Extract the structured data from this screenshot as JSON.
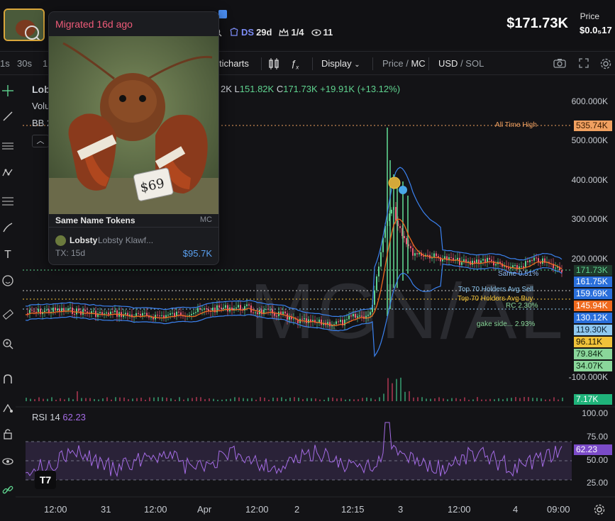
{
  "header": {
    "stats": [
      {
        "icon": "search-icon",
        "label": ""
      },
      {
        "icon": "chef-hat-icon",
        "label": "DS",
        "value": "29d"
      },
      {
        "icon": "crown-icon",
        "label": "1/4"
      },
      {
        "icon": "eye-icon",
        "label": "11"
      }
    ],
    "market_cap": "$171.73K",
    "price_label": "Price",
    "price_value": "$0.0₅17"
  },
  "toolbar": {
    "intervals": [
      "1s",
      "30s",
      "1"
    ],
    "tradingview_label": "ticharts",
    "display_label": "Display",
    "price_mc_dim": "Price /",
    "price_mc_active": "MC",
    "usd_active": "USD",
    "usd_sol_dim": "/ SOL"
  },
  "chart": {
    "symbol": "Lob",
    "volume_label": "Volu",
    "bb_label": "BB 2",
    "ohlc": {
      "h_partial": "2K",
      "l_label": "L",
      "l": "151.82K",
      "c_label": "C",
      "c": "171.73K",
      "change": "+19.91K (+13.12%)"
    },
    "watermark": "MGN/AL",
    "y_axis": [
      "600.000K",
      "500.000K",
      "400.000K",
      "300.000K",
      "200.000K",
      "-100.000K"
    ],
    "price_tags": [
      {
        "text": "535.74K",
        "bg": "#f0a060",
        "fg": "#3a1a00"
      },
      {
        "text": "171.73K",
        "bg": "#1f3a2c",
        "fg": "#5fd38f"
      },
      {
        "text": "161.75K",
        "bg": "#2a6fdb",
        "fg": "#ffffff"
      },
      {
        "text": "159.69K",
        "bg": "#2a6fdb",
        "fg": "#ffffff"
      },
      {
        "text": "145.94K",
        "bg": "#f06a1e",
        "fg": "#ffffff"
      },
      {
        "text": "130.12K",
        "bg": "#2a6fdb",
        "fg": "#ffffff"
      },
      {
        "text": "119.30K",
        "bg": "#8fc8f0",
        "fg": "#0e2438"
      },
      {
        "text": "96.11K",
        "bg": "#f0c23a",
        "fg": "#1a1400"
      },
      {
        "text": "79.84K",
        "bg": "#8ad69a",
        "fg": "#0e2a14"
      },
      {
        "text": "34.07K",
        "bg": "#8ad69a",
        "fg": "#0e2a14"
      },
      {
        "text": "7.17K",
        "bg": "#1fb37a",
        "fg": "#ffffff"
      }
    ],
    "annotations": {
      "ath": "All Time High",
      "same": "Same 0.51%",
      "top70_sell": "Top 70 Holders Avg Sell",
      "top70_buy": "Top 70 Holders Avg Buy",
      "rc": "RC 2.30%",
      "gake": "gake side... 2.93%"
    },
    "rsi": {
      "label": "RSI 14",
      "value": "62.23",
      "axis": [
        "100.00",
        "75.00",
        "50.00",
        "25.00"
      ],
      "tag": "62.23"
    },
    "time_axis": [
      "12:00",
      "31",
      "12:00",
      "Apr",
      "12:00",
      "2",
      "12:15",
      "3",
      "12:00",
      "4",
      "09:00"
    ]
  },
  "popup": {
    "title": "Migrated 16d ago",
    "same_name_title": "Same Name Tokens",
    "same_name_mc": "MC",
    "token_name": "Lobsty",
    "token_full_name": "Lobsty Klawf...",
    "tx": "TX: 15d",
    "mc_value": "$95.7K",
    "price_tag": "$69"
  },
  "colors": {
    "up": "#5fd38f",
    "down": "#ef5b79",
    "bb": "#3b82f0",
    "ma": "#f06a1e",
    "rsi": "#a56ce6",
    "ath": "#f0a060"
  }
}
